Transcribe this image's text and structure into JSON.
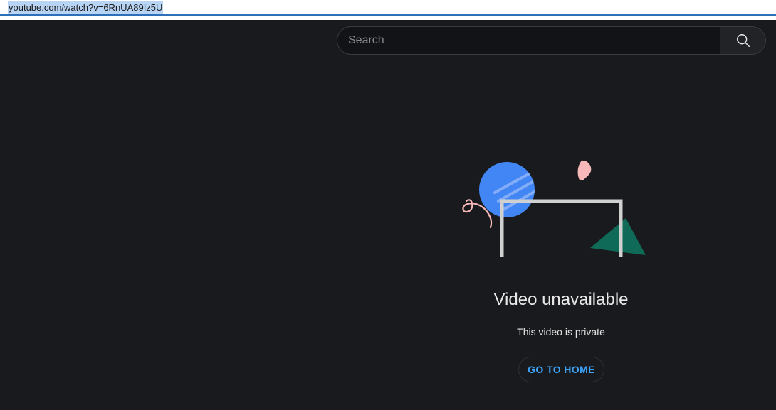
{
  "browser": {
    "url": "youtube.com/watch?v=6RnUA89Iz5U"
  },
  "header": {
    "search_placeholder": "Search",
    "search_icon": "search-icon"
  },
  "error": {
    "title": "Video unavailable",
    "message": "This video is private",
    "home_button_label": "GO TO HOME"
  },
  "colors": {
    "background": "#181a1d",
    "accent_link": "#3ea6ff",
    "illustration_blue": "#4285f4",
    "illustration_green": "#0f6b57",
    "illustration_pink": "#f6b8b8",
    "illustration_frame": "#d0d0d0"
  }
}
